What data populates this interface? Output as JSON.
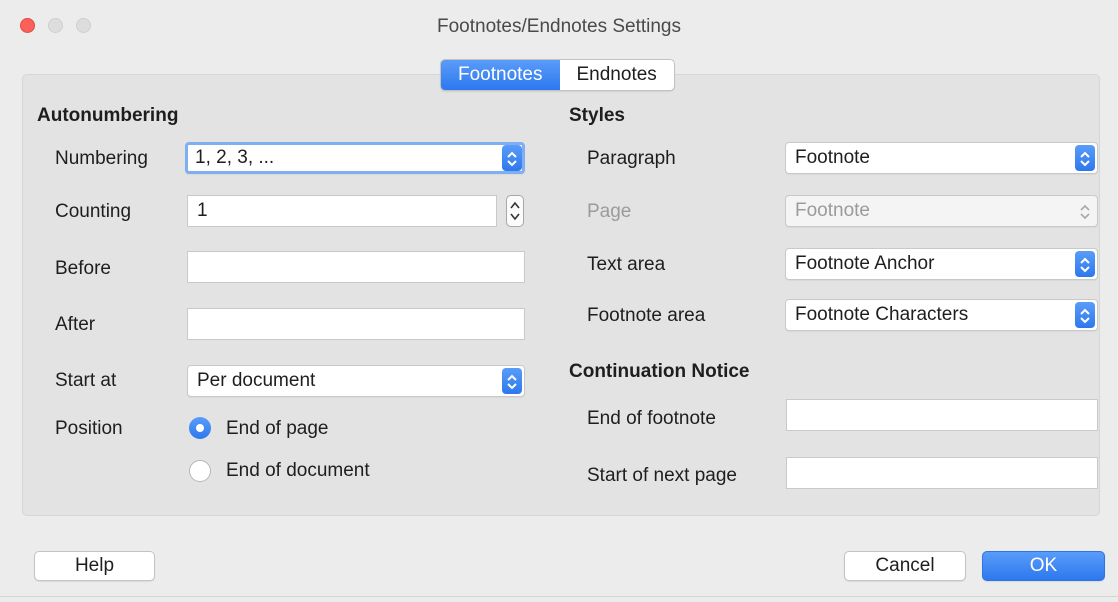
{
  "window": {
    "title": "Footnotes/Endnotes Settings"
  },
  "tabs": [
    {
      "label": "Footnotes",
      "active": true
    },
    {
      "label": "Endnotes",
      "active": false
    }
  ],
  "autonumbering": {
    "heading": "Autonumbering",
    "numbering": {
      "label": "Numbering",
      "value": "1, 2, 3, ..."
    },
    "counting": {
      "label": "Counting",
      "value": "1"
    },
    "before": {
      "label": "Before",
      "value": ""
    },
    "after": {
      "label": "After",
      "value": ""
    },
    "start_at": {
      "label": "Start at",
      "value": "Per document"
    },
    "position": {
      "label": "Position",
      "options": [
        {
          "label": "End of page",
          "selected": true
        },
        {
          "label": "End of document",
          "selected": false
        }
      ]
    }
  },
  "styles": {
    "heading": "Styles",
    "paragraph": {
      "label": "Paragraph",
      "value": "Footnote"
    },
    "page": {
      "label": "Page",
      "value": "Footnote",
      "disabled": true
    },
    "text_area": {
      "label": "Text area",
      "value": "Footnote Anchor"
    },
    "footnote_area": {
      "label": "Footnote area",
      "value": "Footnote Characters"
    }
  },
  "continuation": {
    "heading": "Continuation Notice",
    "end_of_footnote": {
      "label": "End of footnote",
      "value": ""
    },
    "start_of_next_page": {
      "label": "Start of next page",
      "value": ""
    }
  },
  "buttons": {
    "help": "Help",
    "cancel": "Cancel",
    "ok": "OK"
  },
  "colors": {
    "accent": "#2d78ee",
    "close": "#fc605b",
    "background": "#ececec"
  }
}
